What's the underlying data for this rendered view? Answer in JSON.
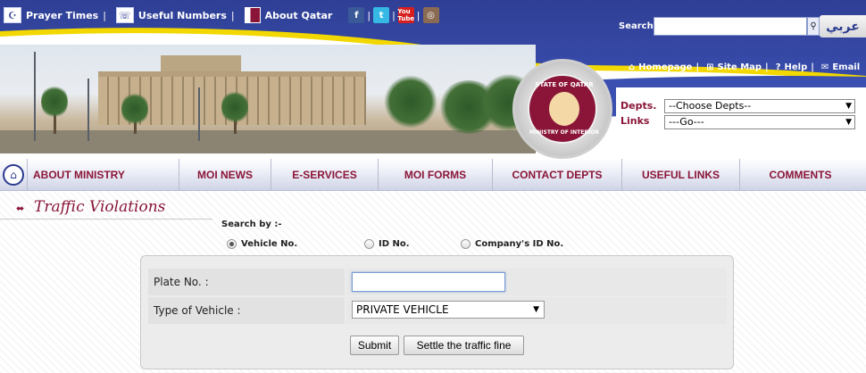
{
  "topbar": {
    "links": [
      {
        "label": "Prayer Times",
        "sep": "|"
      },
      {
        "label": "Useful Numbers",
        "sep": "|"
      },
      {
        "label": "About Qatar",
        "sep": ""
      }
    ],
    "social": [
      "facebook-icon",
      "twitter-icon",
      "youtube-icon",
      "instagram-icon"
    ],
    "social_text": {
      "fb": "f",
      "tw": "t",
      "yt": "You Tube",
      "ig": "◎"
    },
    "search_label": "Search",
    "search_value": "",
    "arabic_label": "عربي"
  },
  "emblem": {
    "top_text": "STATE OF QATAR",
    "bottom_text": "MINISTRY OF INTERIOR"
  },
  "utility": [
    {
      "label": "Homepage",
      "sep": "|"
    },
    {
      "label": "Site Map",
      "sep": "|"
    },
    {
      "label": "Help",
      "sep": "|"
    },
    {
      "label": "Email",
      "sep": ""
    }
  ],
  "depts": {
    "label": "Depts.",
    "value": "--Choose Depts--"
  },
  "links": {
    "label": "Links",
    "value": "---Go---"
  },
  "nav": [
    "ABOUT MINISTRY",
    "MOI NEWS",
    "E-SERVICES",
    "MOI FORMS",
    "CONTACT DEPTS",
    "USEFUL LINKS",
    "COMMENTS"
  ],
  "page": {
    "title": "Traffic Violations",
    "search_by": "Search by :-",
    "radios": [
      {
        "label": "Vehicle No.",
        "selected": true
      },
      {
        "label": "ID No.",
        "selected": false
      },
      {
        "label": "Company's ID No.",
        "selected": false
      }
    ],
    "form": {
      "plate_label": "Plate No. :",
      "plate_value": "",
      "vehicle_label": "Type of Vehicle :",
      "vehicle_value": "PRIVATE VEHICLE"
    },
    "buttons": {
      "submit": "Submit",
      "settle": "Settle the traffic fine"
    }
  },
  "colors": {
    "brand": "#8a1538",
    "header_blue": "#3a4fb0",
    "accent_yellow": "#f2d800"
  }
}
